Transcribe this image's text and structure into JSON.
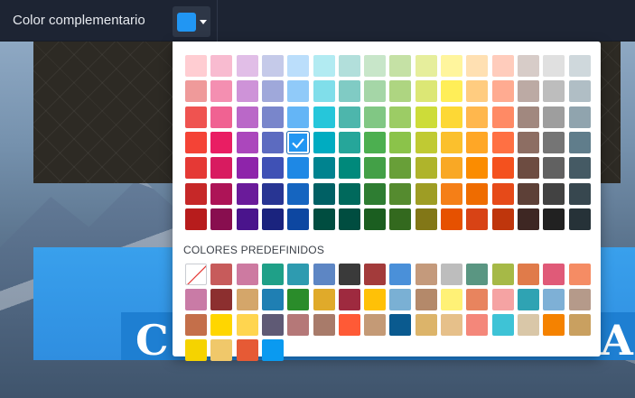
{
  "toolbar": {
    "label": "Color complementario",
    "current_color": "#2196f3"
  },
  "picker": {
    "selected": "#2196f3",
    "palette": [
      [
        "#ffcdd2",
        "#f8bbd0",
        "#e1bee7",
        "#c5cae9",
        "#bbdefb",
        "#b2ebf2",
        "#b2dfdb",
        "#c8e6c9",
        "#c5e1a5",
        "#e6ee9c",
        "#fff59d",
        "#ffe0b2",
        "#ffccbc",
        "#d7ccc8",
        "#e0e0e0",
        "#cfd8dc"
      ],
      [
        "#ef9a9a",
        "#f48fb1",
        "#ce93d8",
        "#9fa8da",
        "#90caf9",
        "#80deea",
        "#80cbc4",
        "#a5d6a7",
        "#aed581",
        "#dce775",
        "#ffee58",
        "#ffcc80",
        "#ffab91",
        "#bcaaa4",
        "#bdbdbd",
        "#b0bec5"
      ],
      [
        "#ef5350",
        "#f06292",
        "#ba68c8",
        "#7986cb",
        "#64b5f6",
        "#26c6da",
        "#4db6ac",
        "#81c784",
        "#9ccc65",
        "#cddc39",
        "#fdd835",
        "#ffb74d",
        "#ff8a65",
        "#a1887f",
        "#9e9e9e",
        "#90a4ae"
      ],
      [
        "#f44336",
        "#e91e63",
        "#ab47bc",
        "#5c6bc0",
        "#2196f3",
        "#00acc1",
        "#26a69a",
        "#4caf50",
        "#8bc34a",
        "#c0ca33",
        "#fbc02d",
        "#ffa726",
        "#ff7043",
        "#8d6e63",
        "#757575",
        "#607d8b"
      ],
      [
        "#e53935",
        "#d81b60",
        "#8e24aa",
        "#3f51b5",
        "#1e88e5",
        "#00838f",
        "#00897b",
        "#43a047",
        "#689f38",
        "#afb42b",
        "#f9a825",
        "#fb8c00",
        "#f4511e",
        "#6d4c41",
        "#616161",
        "#455a64"
      ],
      [
        "#c62828",
        "#ad1457",
        "#6a1b9a",
        "#283593",
        "#1565c0",
        "#006064",
        "#00695c",
        "#2e7d32",
        "#558b2f",
        "#9e9d24",
        "#f57f17",
        "#ef6c00",
        "#e64a19",
        "#5d4037",
        "#424242",
        "#37474f"
      ],
      [
        "#b71c1c",
        "#880e4f",
        "#4a148c",
        "#1a237e",
        "#0d47a1",
        "#004d40",
        "#004d40",
        "#1b5e20",
        "#33691e",
        "#827717",
        "#e65100",
        "#d84315",
        "#bf360c",
        "#3e2723",
        "#212121",
        "#263238"
      ]
    ],
    "predefined_title": "COLORES PREDEFINIDOS",
    "predefined": [
      [
        "none",
        "#c75b5b",
        "#cd7aa1",
        "#1fa088",
        "#2e9bb0",
        "#5d86c4",
        "#3a3a3a",
        "#a33b3b",
        "#4a90d9",
        "#c49a7c",
        "#bdbdbd",
        "#5a9682",
        "#a6b947",
        "#e07b4a",
        "#e05a78",
        "#f58c64"
      ],
      [
        "#c97ba6",
        "#8c2f2f",
        "#d4a66a",
        "#1f7fb3",
        "#2a8c2a",
        "#e0aa2a",
        "#9e2a3f",
        "#ffc107",
        "#7ab0d4",
        "#b4896a",
        "#fff176",
        "#e8845e",
        "#f5a3a3",
        "#2fa3b3",
        "#7eb0d6",
        "#b59a8a"
      ],
      [
        "#c46f4a",
        "#ffd600",
        "#ffd54f",
        "#5f5a75",
        "#b57878",
        "#a87b6a",
        "#ff5a36",
        "#c49a76",
        "#0a5a8f",
        "#dcb46a",
        "#e6c08a",
        "#f4877a",
        "#3ec3d6",
        "#d9c7a8",
        "#f58200",
        "#c9a060"
      ],
      [
        "#f5d300",
        "#f0c86a",
        "#e65a35",
        "#0a9af0"
      ]
    ]
  },
  "background": {
    "banner_text": "COMIENZA A CREAR"
  }
}
